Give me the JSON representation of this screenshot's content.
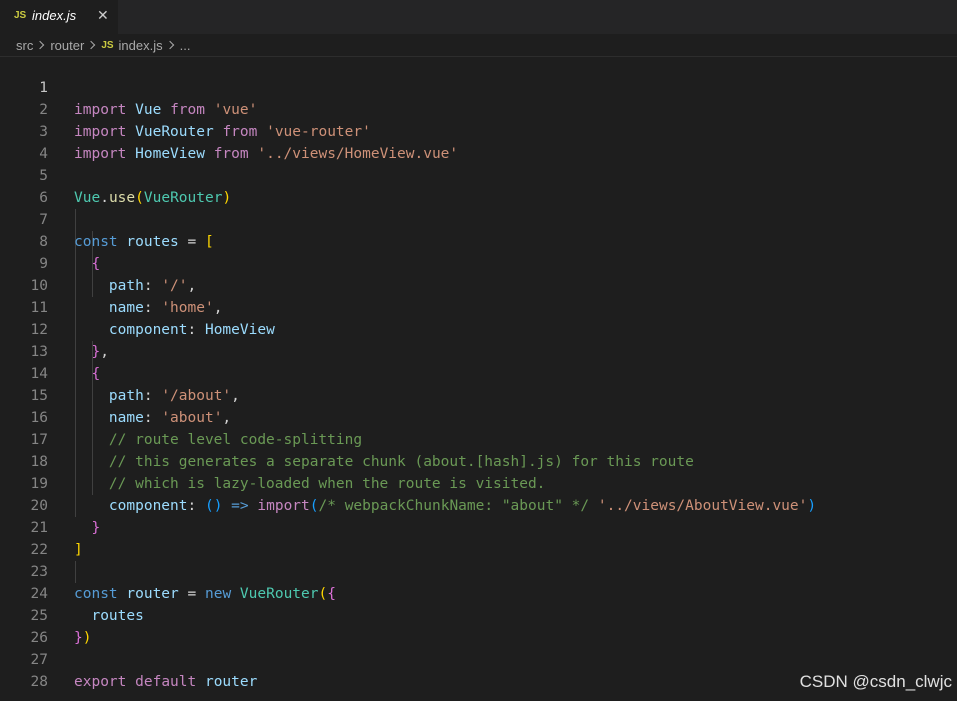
{
  "tab": {
    "badge": "JS",
    "filename": "index.js",
    "close_glyph": "✕"
  },
  "breadcrumb": {
    "items": [
      "src",
      "router",
      "index.js",
      "..."
    ],
    "file_badge": "JS"
  },
  "editor": {
    "active_line": 1,
    "line_numbers": [
      "1",
      "2",
      "3",
      "4",
      "5",
      "6",
      "7",
      "8",
      "9",
      "10",
      "11",
      "12",
      "13",
      "14",
      "15",
      "16",
      "17",
      "18",
      "19",
      "20",
      "21",
      "22",
      "23",
      "24",
      "25",
      "26",
      "27",
      "28"
    ],
    "tokens": {
      "l1": [
        "import",
        " ",
        "Vue",
        " ",
        "from",
        " ",
        "'vue'"
      ],
      "l2": [
        "import",
        " ",
        "VueRouter",
        " ",
        "from",
        " ",
        "'vue-router'"
      ],
      "l3": [
        "import",
        " ",
        "HomeView",
        " ",
        "from",
        " ",
        "'../views/HomeView.vue'"
      ],
      "l5": [
        "Vue",
        ".",
        "use",
        "(",
        "VueRouter",
        ")"
      ],
      "l7": [
        "const",
        " ",
        "routes",
        " = ",
        "["
      ],
      "l8": [
        "  ",
        "{"
      ],
      "l9": [
        "    ",
        "path",
        ": ",
        "'/'",
        ","
      ],
      "l10": [
        "    ",
        "name",
        ": ",
        "'home'",
        ","
      ],
      "l11": [
        "    ",
        "component",
        ": ",
        "HomeView"
      ],
      "l12": [
        "  ",
        "}",
        ","
      ],
      "l13": [
        "  ",
        "{"
      ],
      "l14": [
        "    ",
        "path",
        ": ",
        "'/about'",
        ","
      ],
      "l15": [
        "    ",
        "name",
        ": ",
        "'about'",
        ","
      ],
      "l16": [
        "    ",
        "// route level code-splitting"
      ],
      "l17": [
        "    ",
        "// this generates a separate chunk (about.[hash].js) for this route"
      ],
      "l18": [
        "    ",
        "// which is lazy-loaded when the route is visited."
      ],
      "l19": [
        "    ",
        "component",
        ": ",
        "()",
        " ",
        "=>",
        " ",
        "import",
        "(",
        "/* webpackChunkName: \"about\" */",
        " ",
        "'../views/AboutView.vue'",
        ")"
      ],
      "l20": [
        "  ",
        "}"
      ],
      "l21": [
        "]"
      ],
      "l23": [
        "const",
        " ",
        "router",
        " = ",
        "new",
        " ",
        "VueRouter",
        "(",
        "{"
      ],
      "l24": [
        "  ",
        "routes"
      ],
      "l25": [
        "}",
        ")"
      ],
      "l27": [
        "export",
        " ",
        "default",
        " ",
        "router"
      ]
    }
  },
  "watermark": "CSDN @csdn_clwjc",
  "colors": {
    "background": "#1e1e1e",
    "keyword": "#c586c0",
    "declaration": "#569cd6",
    "variable": "#9cdcfe",
    "class": "#4ec9b0",
    "function": "#dcdcaa",
    "string": "#ce9178",
    "comment": "#6a9955",
    "bracket_level1": "#ffd700",
    "bracket_level2": "#da70d6",
    "bracket_level3": "#179fff"
  },
  "icons": [
    "js-file-icon",
    "close-icon",
    "chevron-right-icon"
  ]
}
